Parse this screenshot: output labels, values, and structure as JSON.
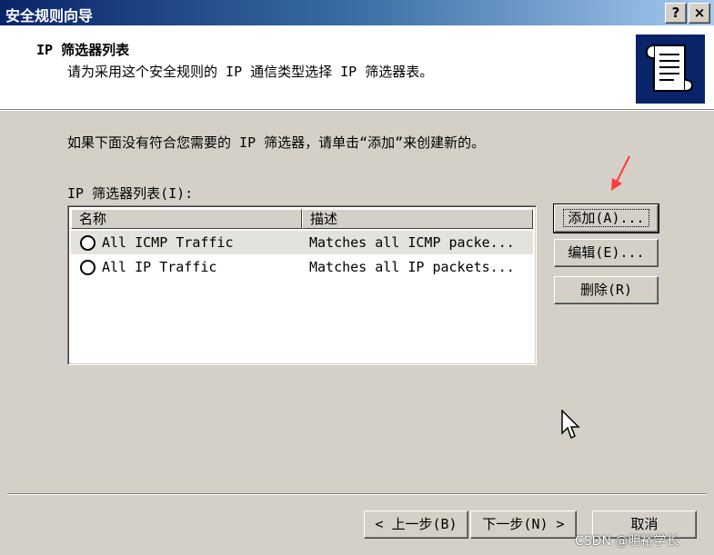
{
  "window": {
    "title": "安全规则向导",
    "help_label": "?",
    "close_label": "×"
  },
  "header": {
    "title": "IP 筛选器列表",
    "subtitle": "请为采用这个安全规则的 IP 通信类型选择 IP 筛选器表。"
  },
  "body": {
    "instruction": "如果下面没有符合您需要的 IP 筛选器，请单击“添加”来创建新的。",
    "list_label": "IP 筛选器列表(I):"
  },
  "list": {
    "columns": [
      "名称",
      "描述"
    ],
    "rows": [
      {
        "name": "All ICMP Traffic",
        "desc": "Matches all ICMP packe...",
        "selected": true
      },
      {
        "name": "All IP Traffic",
        "desc": "Matches all IP packets...",
        "selected": false
      }
    ]
  },
  "side_buttons": {
    "add": "添加(A)...",
    "edit": "编辑(E)...",
    "delete": "删除(R)"
  },
  "nav_buttons": {
    "back": "< 上一步(B)",
    "next": "下一步(N) >",
    "cancel": "取消"
  },
  "watermark": "CSDN @明裕学长",
  "colors": {
    "titlebar_start": "#0a246a",
    "titlebar_end": "#a6caf0",
    "arrow": "#ff3b3b",
    "dialog_bg": "#d4d0c8"
  }
}
